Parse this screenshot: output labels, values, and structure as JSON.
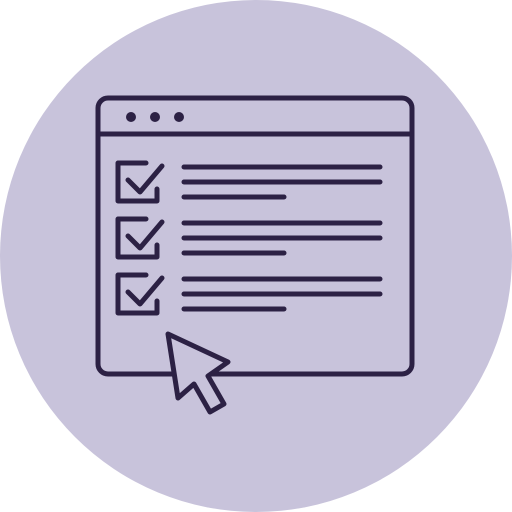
{
  "colors": {
    "background_circle": "#c8c3db",
    "stroke": "#2c2144",
    "page": "#ffffff"
  },
  "icon": {
    "name": "checklist-browser-cursor-icon",
    "window_dots": 3,
    "checked_items": 3,
    "text_lines_per_item": 3
  }
}
